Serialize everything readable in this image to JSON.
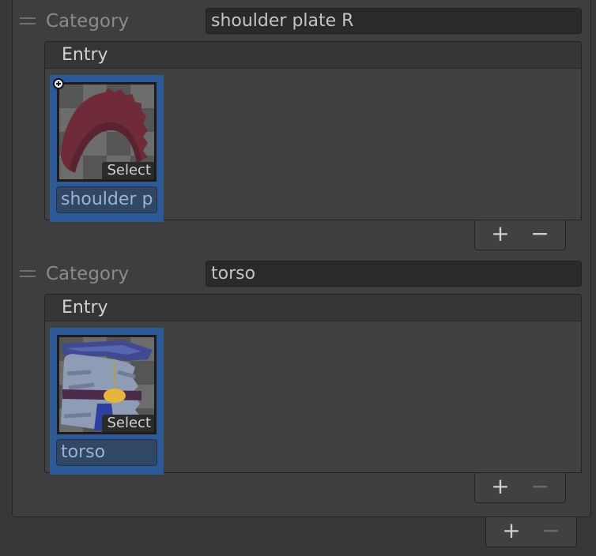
{
  "categories": [
    {
      "label": "Category",
      "value": "shoulder plate R",
      "entry_header": "Entry",
      "entry": {
        "select_label": "Select",
        "name": "shoulder p",
        "thumbnail": "shoulder-plate-sprite"
      },
      "add_symbol": "+",
      "remove_symbol": "−"
    },
    {
      "label": "Category",
      "value": "torso",
      "entry_header": "Entry",
      "entry": {
        "select_label": "Select",
        "name": "torso",
        "thumbnail": "torso-sprite"
      },
      "add_symbol": "+",
      "remove_symbol": "−"
    }
  ],
  "outer_footer": {
    "add_symbol": "+",
    "remove_symbol": "−"
  },
  "colors": {
    "selection": "#2d5a97",
    "name_field": "#304766",
    "shoulder_plate": "#6f2c38",
    "torso_cloth": "#3f4a90",
    "torso_belt": "#e6b53e"
  }
}
